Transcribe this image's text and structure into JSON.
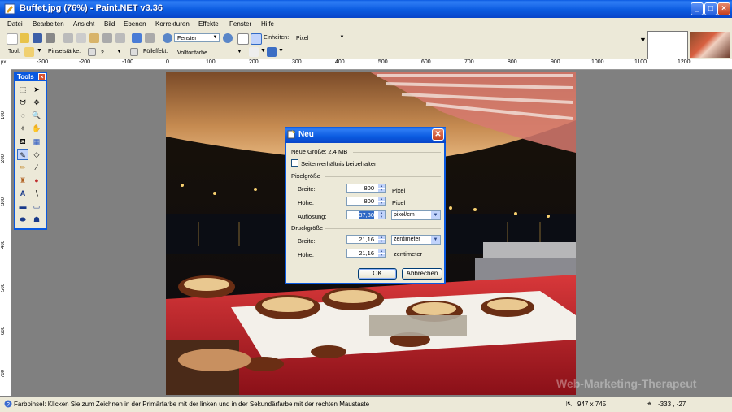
{
  "window": {
    "title": "Buffet.jpg (76%) - Paint.NET v3.36"
  },
  "menubar": {
    "items": [
      "Datei",
      "Bearbeiten",
      "Ansicht",
      "Bild",
      "Ebenen",
      "Korrekturen",
      "Effekte",
      "Fenster",
      "Hilfe"
    ]
  },
  "toolbar": {
    "zoom_mode": "Fenster",
    "units_label": "Einheiten:",
    "units_value": "Pixel",
    "tool_label": "Tool:",
    "brush_width_label": "Pinselstärke:",
    "brush_width_value": "2",
    "fill_label": "Fülleffekt:",
    "fill_value": "Vollton­farbe"
  },
  "ruler": {
    "corner": "px",
    "h_labels": [
      "-300",
      "-200",
      "-100",
      "0",
      "100",
      "200",
      "300",
      "400",
      "500",
      "600",
      "700",
      "800",
      "900",
      "1000",
      "1100",
      "1200"
    ],
    "v_labels": [
      "100",
      "200",
      "300",
      "400",
      "500",
      "600",
      "700"
    ]
  },
  "tools_window": {
    "title": "Tools"
  },
  "dialog": {
    "title": "Neu",
    "new_size": "Neue Größe: 2,4 MB",
    "keep_ratio": "Seitenverhältnis beibehalten",
    "pixel_group": "Pixelgröße",
    "width_label": "Breite:",
    "width_value": "800",
    "width_unit": "Pixel",
    "height_label": "Höhe:",
    "height_value": "800",
    "height_unit": "Pixel",
    "resolution_label": "Auflösung:",
    "resolution_value": "37,80",
    "resolution_unit": "pixel/cm",
    "print_group": "Druckgröße",
    "print_width_label": "Breite:",
    "print_width_value": "21,16",
    "print_width_unit": "zentimeter",
    "print_height_label": "Höhe:",
    "print_height_value": "21,16",
    "print_height_unit": "zentimeter",
    "ok": "OK",
    "cancel": "Abbrechen"
  },
  "statusbar": {
    "hint": "Farbpinsel: Klicken Sie zum Zeichnen in der Primärfarbe mit der linken und in der Sekundärfarbe mit der rechten Maustaste",
    "image_size": "947 x 745",
    "cursor_pos": "-333 , -27"
  },
  "watermark": "Web-Marketing-Therapeut"
}
